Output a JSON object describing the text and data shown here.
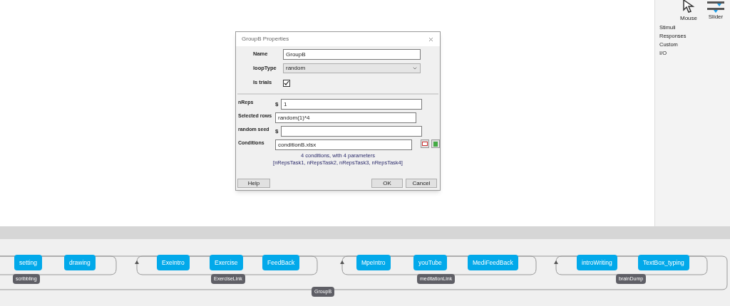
{
  "components": [
    {
      "label": "Mouse",
      "kind": "mouse"
    },
    {
      "label": "Slider",
      "kind": "slider"
    }
  ],
  "categories": [
    "Stimuli",
    "Responses",
    "Custom",
    "I/O"
  ],
  "dialog": {
    "title": "GroupB Properties",
    "top_fields": [
      {
        "label": "Name",
        "kind": "text",
        "value": "GroupB"
      },
      {
        "label": "loopType",
        "kind": "select",
        "value": "random"
      },
      {
        "label": "Is trials",
        "kind": "checkbox",
        "checked": true
      }
    ],
    "fields": [
      {
        "label": "nReps",
        "dollar": "$",
        "value": "1"
      },
      {
        "label": "Selected rows",
        "value": "random(1)*4"
      },
      {
        "label": "random seed",
        "dollar": "$"
      },
      {
        "label": "Conditions",
        "value": "conditionB.xlsx",
        "file": true
      }
    ],
    "info": [
      "4 conditions, with 4 parameters",
      "[nRepsTask1, nRepsTask2, nRepsTask3, nRepsTask4]"
    ],
    "buttons": {
      "help": "Help",
      "ok": "OK",
      "cancel": "Cancel"
    }
  },
  "flow": {
    "loops": [
      {
        "name": "scribbling",
        "routines": [
          "setting",
          "drawing"
        ]
      },
      {
        "name": "ExerciseLink",
        "routines": [
          "ExeIntro",
          "Exercise",
          "FeedBack"
        ]
      },
      {
        "name": "meditationLink",
        "routines": [
          "MpeIntro",
          "youTube",
          "MediFeedBack"
        ]
      },
      {
        "name": "brainDump",
        "routines": [
          "introWriting",
          "TextBox_typing"
        ]
      }
    ],
    "outer_loop": "GroupB"
  }
}
